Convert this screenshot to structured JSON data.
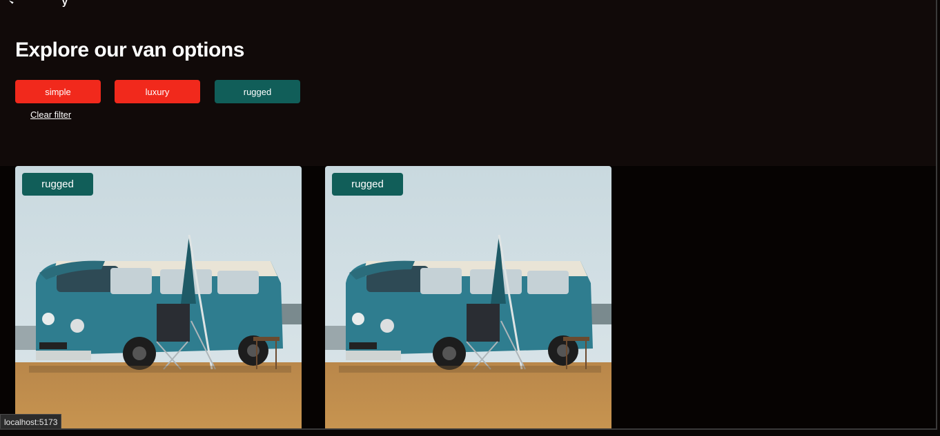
{
  "page": {
    "title": "Explore our van options"
  },
  "filters": {
    "buttons": [
      {
        "label": "simple",
        "color": "#f1291c"
      },
      {
        "label": "luxury",
        "color": "#f1291c"
      },
      {
        "label": "rugged",
        "color": "#115e59"
      }
    ],
    "clear_label": "Clear filter"
  },
  "vans": [
    {
      "type": "rugged",
      "badge_color": "#115e59",
      "image": "vw-camper-van-photo"
    },
    {
      "type": "rugged",
      "badge_color": "#115e59",
      "image": "vw-camper-van-photo"
    }
  ],
  "status_bar": {
    "url": "localhost:5173"
  },
  "colors": {
    "background": "#120a09",
    "accent_red": "#f1291c",
    "accent_teal": "#115e59"
  }
}
